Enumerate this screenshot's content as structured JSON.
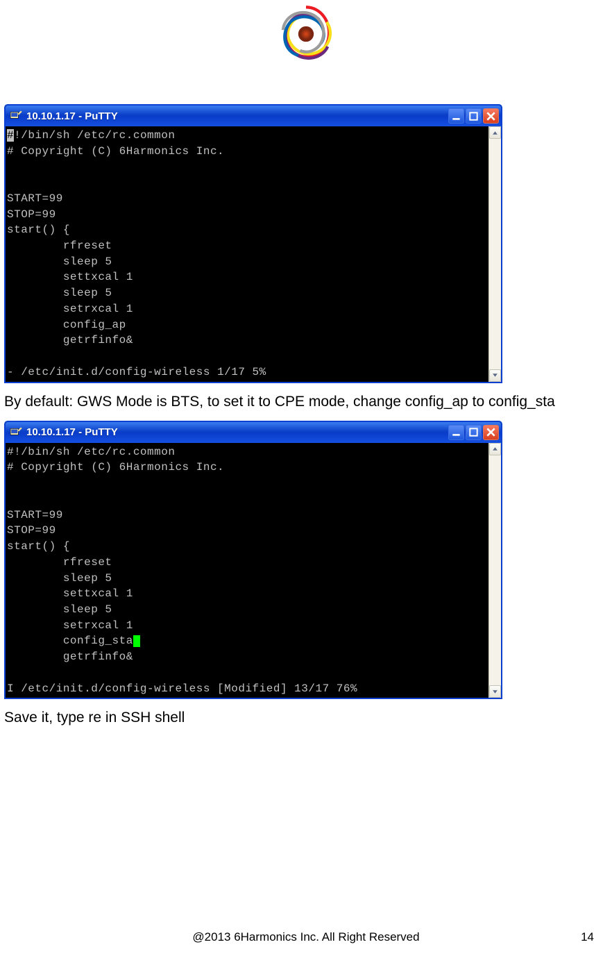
{
  "logo_name": "6harmonics-logo",
  "windows": [
    {
      "title": "10.10.1.17 - PuTTY",
      "lines": [
        {
          "segments": [
            {
              "t": "#",
              "hl": true
            },
            {
              "t": "!/bin/sh /etc/rc.common"
            }
          ]
        },
        {
          "segments": [
            {
              "t": "# Copyright (C) 6Harmonics Inc."
            }
          ]
        },
        {
          "segments": [
            {
              "t": ""
            }
          ]
        },
        {
          "segments": [
            {
              "t": ""
            }
          ]
        },
        {
          "segments": [
            {
              "t": "START=99"
            }
          ]
        },
        {
          "segments": [
            {
              "t": "STOP=99"
            }
          ]
        },
        {
          "segments": [
            {
              "t": "start() {"
            }
          ]
        },
        {
          "segments": [
            {
              "t": "        rfreset"
            }
          ]
        },
        {
          "segments": [
            {
              "t": "        sleep 5"
            }
          ]
        },
        {
          "segments": [
            {
              "t": "        settxcal 1"
            }
          ]
        },
        {
          "segments": [
            {
              "t": "        sleep 5"
            }
          ]
        },
        {
          "segments": [
            {
              "t": "        setrxcal 1"
            }
          ]
        },
        {
          "segments": [
            {
              "t": "        config_ap"
            }
          ]
        },
        {
          "segments": [
            {
              "t": "        getrfinfo&"
            }
          ]
        },
        {
          "segments": [
            {
              "t": ""
            }
          ]
        },
        {
          "segments": [
            {
              "t": "- /etc/init.d/config-wireless 1/17 5%"
            }
          ]
        }
      ]
    },
    {
      "title": "10.10.1.17 - PuTTY",
      "lines": [
        {
          "segments": [
            {
              "t": "#!/bin/sh /etc/rc.common"
            }
          ]
        },
        {
          "segments": [
            {
              "t": "# Copyright (C) 6Harmonics Inc."
            }
          ]
        },
        {
          "segments": [
            {
              "t": ""
            }
          ]
        },
        {
          "segments": [
            {
              "t": ""
            }
          ]
        },
        {
          "segments": [
            {
              "t": "START=99"
            }
          ]
        },
        {
          "segments": [
            {
              "t": "STOP=99"
            }
          ]
        },
        {
          "segments": [
            {
              "t": "start() {"
            }
          ]
        },
        {
          "segments": [
            {
              "t": "        rfreset"
            }
          ]
        },
        {
          "segments": [
            {
              "t": "        sleep 5"
            }
          ]
        },
        {
          "segments": [
            {
              "t": "        settxcal 1"
            }
          ]
        },
        {
          "segments": [
            {
              "t": "        sleep 5"
            }
          ]
        },
        {
          "segments": [
            {
              "t": "        setrxcal 1"
            }
          ]
        },
        {
          "segments": [
            {
              "t": "        config_sta"
            },
            {
              "cursor": true
            }
          ]
        },
        {
          "segments": [
            {
              "t": "        getrfinfo&"
            }
          ]
        },
        {
          "segments": [
            {
              "t": ""
            }
          ]
        },
        {
          "segments": [
            {
              "t": "I /etc/init.d/config-wireless [Modified] 13/17 76%"
            }
          ]
        }
      ]
    }
  ],
  "paragraph1": "By default: GWS Mode is BTS, to set it to CPE mode, change config_ap to config_sta",
  "paragraph2": "Save it, type re in SSH shell",
  "footer_text": "@2013 6Harmonics Inc. All Right Reserved",
  "page_number": "14"
}
